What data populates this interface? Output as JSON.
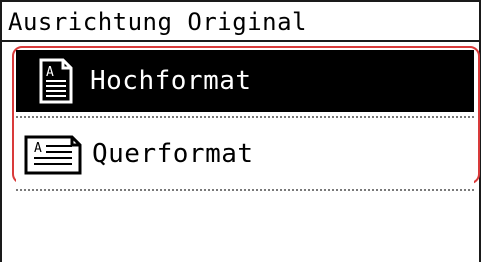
{
  "header": {
    "title": "Ausrichtung Original"
  },
  "options": [
    {
      "label": "Hochformat",
      "icon": "portrait-document-icon",
      "selected": true
    },
    {
      "label": "Querformat",
      "icon": "landscape-document-icon",
      "selected": false
    }
  ],
  "icon_letter": "A",
  "colors": {
    "selected_background": "#000000",
    "selected_text": "#ffffff",
    "focus_border": "#d93a3a",
    "divider": "#7a7a7a"
  }
}
